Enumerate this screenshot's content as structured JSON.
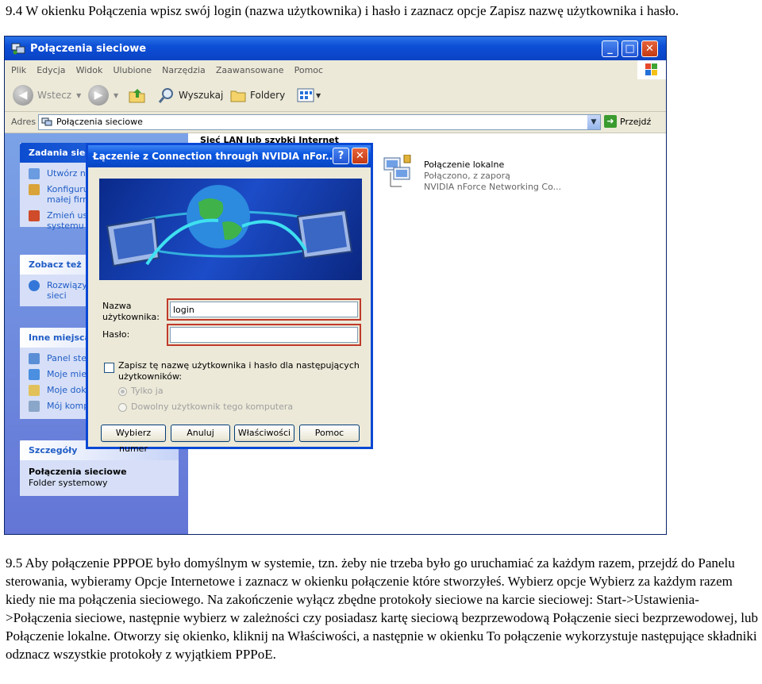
{
  "doc": {
    "p1": "9.4 W okienku Połączenia wpisz swój login (nazwa użytkownika) i hasło i zaznacz opcje Zapisz nazwę użytkownika i hasło.",
    "p2": "9.5 Aby połączenie PPPOE było domyślnym w systemie, tzn. żeby nie trzeba było go uruchamiać za każdym razem, przejdź do Panelu sterowania, wybieramy Opcje Internetowe i zaznacz w okienku połączenie które stworzyłeś. Wybierz opcje Wybierz za każdym razem kiedy nie ma połączenia sieciowego. Na zakończenie wyłącz zbędne protokoły sieciowe na karcie sieciowej: Start->Ustawienia->Połączenia sieciowe, następnie wybierz w zależności czy posiadasz kartę sieciową bezprzewodową Połączenie sieci bezprzewodowej, lub Połączenie lokalne. Otworzy się okienko, kliknij na Właściwości, a następnie w okienku To połączenie wykorzystuje następujące składniki odznacz wszystkie protokoły z wyjątkiem PPPoE."
  },
  "window": {
    "title": "Połączenia sieciowe",
    "menu": [
      "Plik",
      "Edycja",
      "Widok",
      "Ulubione",
      "Narzędzia",
      "Zaawansowane",
      "Pomoc"
    ],
    "toolbar": {
      "back": "Wstecz",
      "search": "Wyszukaj",
      "folders": "Foldery"
    },
    "address": {
      "label": "Adres",
      "value": "Połączenia sieciowe",
      "go": "Przejdź"
    }
  },
  "left_pane": {
    "tasks": {
      "title": "Zadania siec",
      "items": [
        "Utwórz no",
        "Konfiguru",
        "małej firm",
        "Zmień usta",
        "systemu W"
      ]
    },
    "see_also": {
      "title": "Zobacz też",
      "items": [
        "Rozwiązyw",
        "sieci"
      ]
    },
    "other": {
      "title": "Inne miejsca",
      "items": [
        "Panel ster",
        "Moje miejs",
        "Moje doku",
        "Mój kompu"
      ]
    },
    "details": {
      "title": "Szczegóły",
      "name": "Połączenia sieciowe",
      "sub": "Folder systemowy"
    }
  },
  "right_pane": {
    "section": "Sieć LAN lub szybki Internet",
    "connection": {
      "name": "Połączenie lokalne",
      "status": "Połączono, z zaporą",
      "device": "NVIDIA nForce Networking Co..."
    }
  },
  "dialog": {
    "title": "Łączenie z Connection through NVIDIA nFor...",
    "username_label_1": "Nazwa",
    "username_label_2": "użytkownika:",
    "username_value": "login",
    "password_label": "Hasło:",
    "save_label_1": "Zapisz tę nazwę użytkownika i hasło dla następujących",
    "save_label_2": "użytkowników:",
    "radio_me_only": "Tylko ja",
    "radio_anyone": "Dowolny użytkownik tego komputera",
    "buttons": {
      "dial": "Wybierz numer",
      "cancel": "Anuluj",
      "properties": "Właściwości",
      "help": "Pomoc"
    }
  },
  "colors": {
    "xp_blue": "#0a48d4",
    "highlight_red": "#c0392b",
    "task_link": "#215dc6"
  }
}
